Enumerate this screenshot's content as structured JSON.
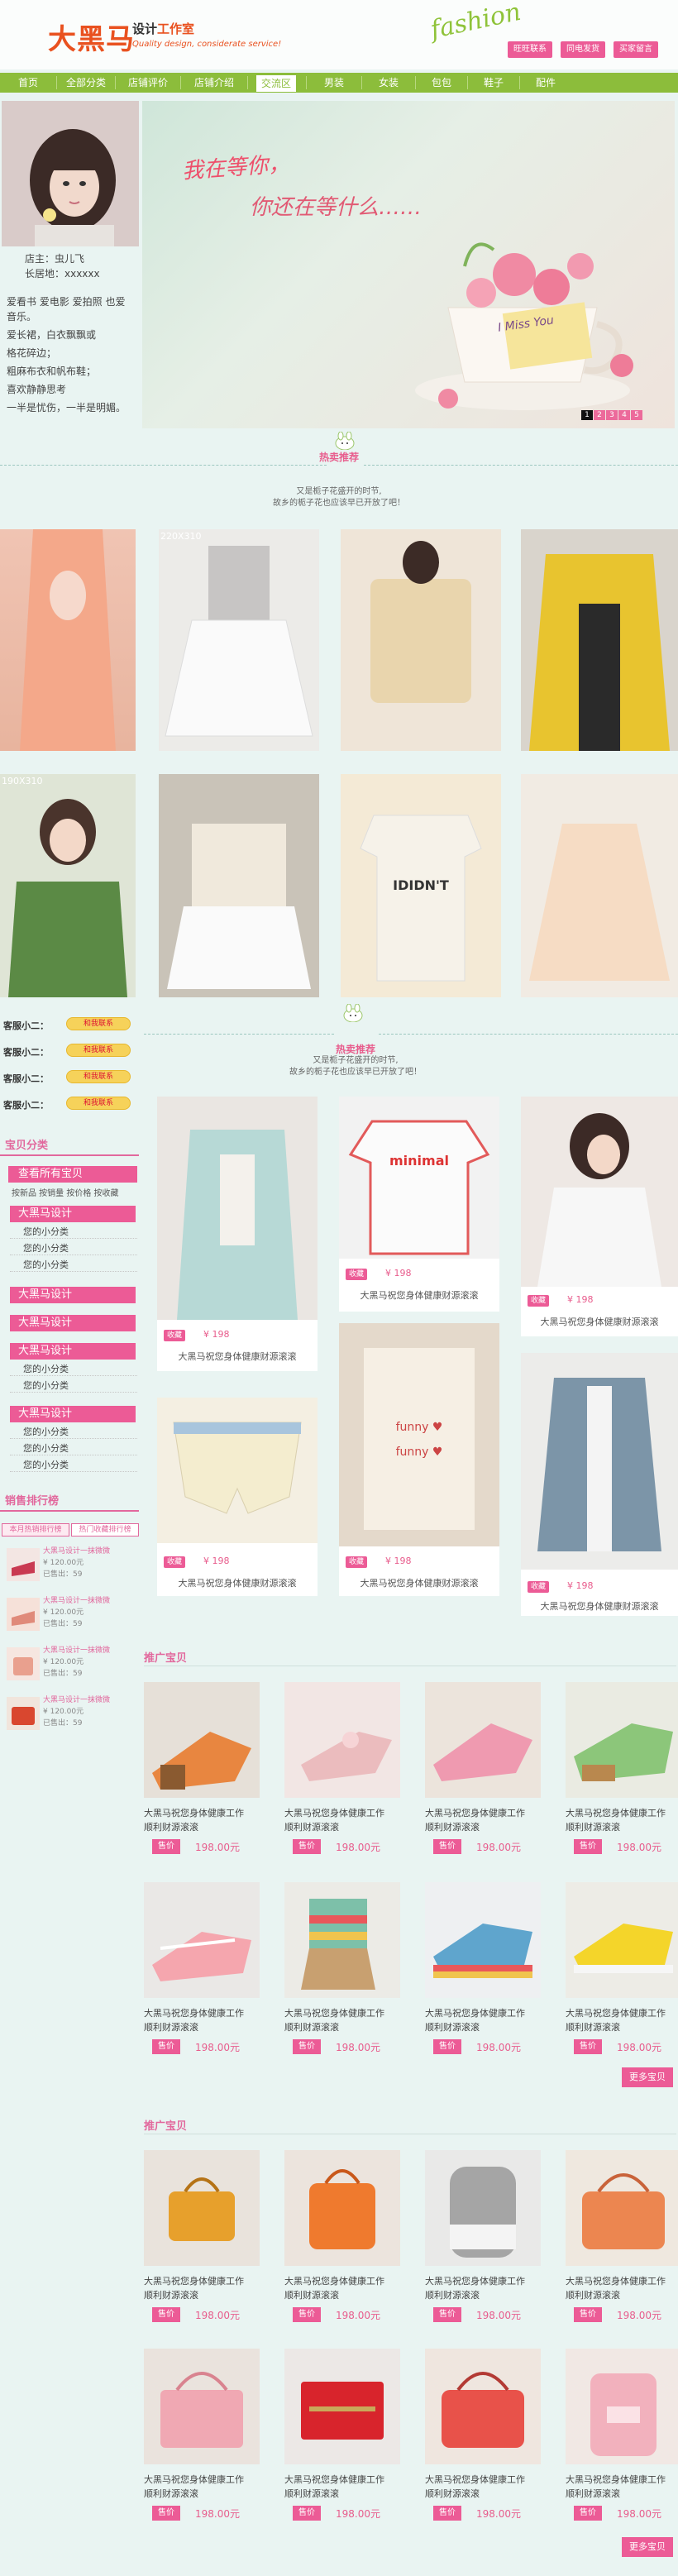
{
  "header": {
    "logo": "大黑马",
    "logo_sub_a": "设计",
    "logo_sub_b": "工作室",
    "logo_en": "Quality design, considerate service!",
    "script_word": "fashion",
    "top_buttons": [
      "旺旺联系",
      "同电发货",
      "买家留言"
    ]
  },
  "nav": {
    "items": [
      "首页",
      "全部分类",
      "店铺评价",
      "店铺介绍",
      "交流区",
      "男装",
      "女装",
      "包包",
      "鞋子",
      "配件"
    ],
    "active_index": 4
  },
  "profile": {
    "owner": "店主：虫儿飞",
    "hometown": "长居地：xxxxxx",
    "bio": [
      "爱看书 爱电影 爱拍照 也爱",
      "音乐。",
      "爱长裙，白衣飘飘或",
      "格花碎边；",
      "粗麻布衣和帆布鞋；",
      "喜欢静静思考",
      "一半是忧伤，一半是明媚。"
    ]
  },
  "banner": {
    "line1": "我在等你，",
    "line2": "你还在等什么……",
    "cup_text": "I Miss You",
    "pager": [
      "1",
      "2",
      "3",
      "4",
      "5"
    ],
    "pager_active": 0,
    "colors": {
      "title": "#ee4f6b"
    }
  },
  "section1": {
    "title": "热卖推荐",
    "desc1": "又是栀子花盛开的时节,",
    "desc2": "故乡的栀子花也应该早已开放了吧！"
  },
  "gallery": {
    "size_label_1": "220X310",
    "size_label_2": "190X310"
  },
  "kefu": {
    "label": "客服小二：",
    "button": "和我联系",
    "count": 4
  },
  "sidebar": {
    "category_title": "宝贝分类",
    "view_all": "查看所有宝贝",
    "sort_links": "按新品 按销量 按价格 按收藏",
    "groups": [
      {
        "name": "大黑马设计",
        "subs": [
          "您的小分类",
          "您的小分类",
          "您的小分类"
        ]
      },
      {
        "name": "大黑马设计",
        "subs": []
      },
      {
        "name": "大黑马设计",
        "subs": []
      },
      {
        "name": "大黑马设计",
        "subs": [
          "您的小分类",
          "您的小分类"
        ]
      },
      {
        "name": "大黑马设计",
        "subs": [
          "您的小分类",
          "您的小分类",
          "您的小分类"
        ]
      }
    ],
    "rank_title": "销售排行榜",
    "rank_tabs": [
      "本月热销排行榜",
      "热门收藏排行榜"
    ],
    "rank_items": [
      {
        "title": "大黑马设计一抹微微",
        "price": "¥ 120.00元",
        "sold": "已售出：59"
      },
      {
        "title": "大黑马设计一抹微微",
        "price": "¥ 120.00元",
        "sold": "已售出：59"
      },
      {
        "title": "大黑马设计一抹微微",
        "price": "¥ 120.00元",
        "sold": "已售出：59"
      },
      {
        "title": "大黑马设计一抹微微",
        "price": "¥ 120.00元",
        "sold": "已售出：59"
      }
    ]
  },
  "section2": {
    "title": "热卖推荐",
    "desc1": "又是栀子花盛开的时节,",
    "desc2": "故乡的栀子花也应该早已开放了吧！"
  },
  "hot_items": {
    "fav_label": "收藏",
    "price": "¥ 198",
    "title": "大黑马祝您身体健康财源滚滚",
    "shirt_word": "minimal"
  },
  "promo1": {
    "title": "推广宝贝",
    "item_title_1": "大黑马祝您身体健康工作",
    "item_title_2": "顺利财源滚滚",
    "btn": "售价",
    "price": "198.00元",
    "more": "更多宝贝"
  },
  "promo2": {
    "title": "推广宝贝",
    "item_title_1": "大黑马祝您身体健康工作",
    "item_title_2": "顺利财源滚滚",
    "btn": "售价",
    "price": "198.00元",
    "more": "更多宝贝"
  }
}
